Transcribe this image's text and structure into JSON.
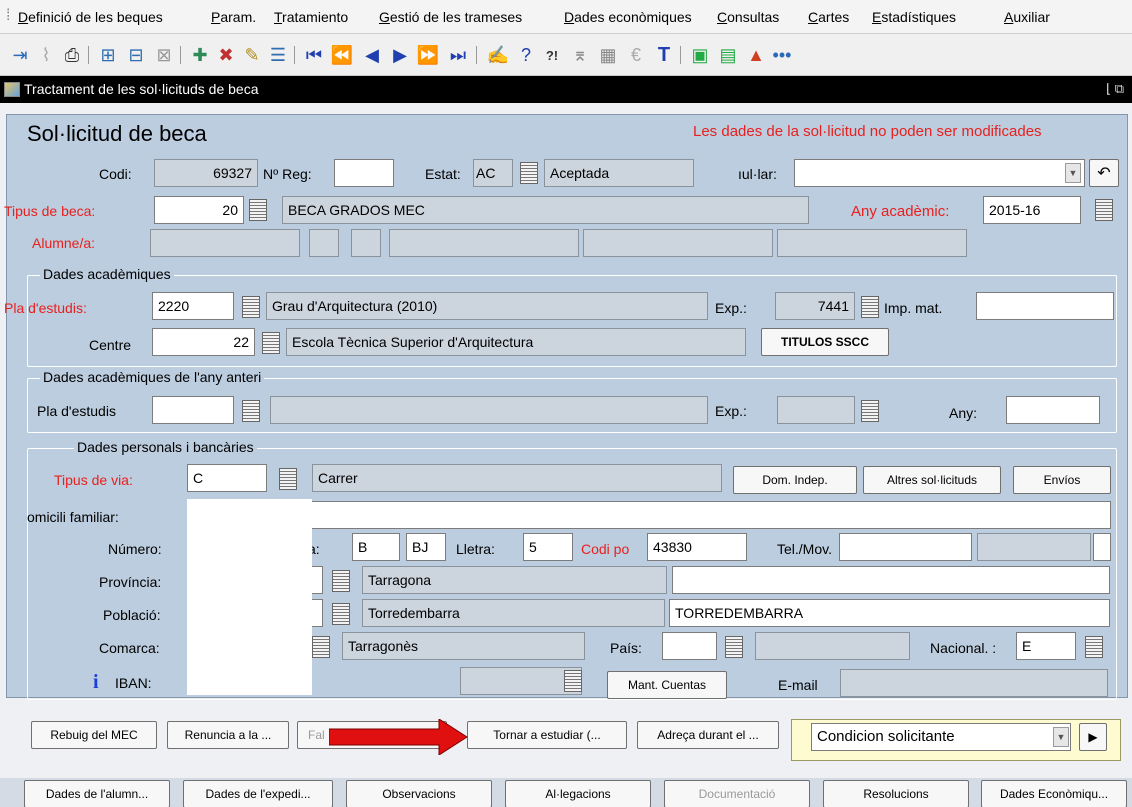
{
  "menu": [
    "Definició de les beques",
    "Param.",
    "Tratamiento",
    "Gestió de les trameses",
    "Dades econòmiques",
    "Consultas",
    "Cartes",
    "Estadístiques",
    "Auxiliar"
  ],
  "window": {
    "title": "Tractament de les sol·licituds de beca"
  },
  "form": {
    "heading": "Sol·licitud de beca",
    "warning": "Les dades de la sol·licitud no poden ser modificades",
    "codi_label": "Codi:",
    "codi": "69327",
    "nreg_label": "Nº Reg:",
    "nreg": "",
    "estat_label": "Estat:",
    "estat_code": "AC",
    "estat_desc": "Aceptada",
    "anul_label": "ıul·lar:",
    "anul": "",
    "tipus_label": "Tipus de beca:",
    "tipus_code": "20",
    "tipus_desc": "BECA GRADOS MEC",
    "any_label": "Any acadèmic:",
    "any": "2015-16",
    "alumne_label": "Alumne/a:"
  },
  "academic": {
    "title": "Dades acadèmiques",
    "pla_label": "Pla d'estudis:",
    "pla_code": "2220",
    "pla_desc": "Grau d'Arquitectura (2010)",
    "exp_label": "Exp.:",
    "exp": "7441",
    "imp_label": "Imp. mat.",
    "imp": "",
    "centre_label": "Centre",
    "centre_code": "22",
    "centre_desc": "Escola Tècnica Superior d'Arquitectura",
    "titulos_btn": "TITULOS SSCC"
  },
  "previous": {
    "title": "Dades acadèmiques de l'any anteri",
    "pla_label": "Pla d'estudis",
    "exp_label": "Exp.:",
    "any_label": "Any:"
  },
  "personal": {
    "title": "Dades personals i bancàries",
    "via_label": "Tipus de via:",
    "via_code": "C",
    "via_desc": "Carrer",
    "dom_btn": "Dom. Indep.",
    "altres_btn": "Altres sol·licituds",
    "envios_btn": "Envíos",
    "domicili_label": "omicili familiar:",
    "numero_label": "Número:",
    "escala_label": "ıla:",
    "escala": "B",
    "pis": "BJ",
    "lletra_label": "Lletra:",
    "lletra": "5",
    "cp_label": "Codi po",
    "cp": "43830",
    "tel_label": "Tel./Mov.",
    "provincia_label": "Província:",
    "provincia": "Tarragona",
    "poblacio_label": "Població:",
    "poblacio": "Torredembarra",
    "poblacio_upper": "TORREDEMBARRA",
    "comarca_label": "Comarca:",
    "comarca": "Tarragonès",
    "pais_label": "País:",
    "nacional_label": "Nacional. :",
    "nacional": "E",
    "iban_label": "IBAN:",
    "mant_btn": "Mant. Cuentas",
    "email_label": "E-mail"
  },
  "actions": {
    "rebuig": "Rebuig del MEC",
    "renuncia": "Renuncia a la ...",
    "falta": "Fal",
    "tornar": "Tornar a estudiar (...",
    "adreca": "Adreça durant el ...",
    "condicion": "Condicion solicitante"
  },
  "tabs": [
    "Dades de l'alumn...",
    "Dades de l'expedi...",
    "Observacions",
    "Al·legacions",
    "Documentació",
    "Resolucions",
    "Dades Econòmiqu..."
  ],
  "colors": {
    "warning": "#e8201e",
    "arrow": "#e01010",
    "highlight": "#fffbd0"
  }
}
